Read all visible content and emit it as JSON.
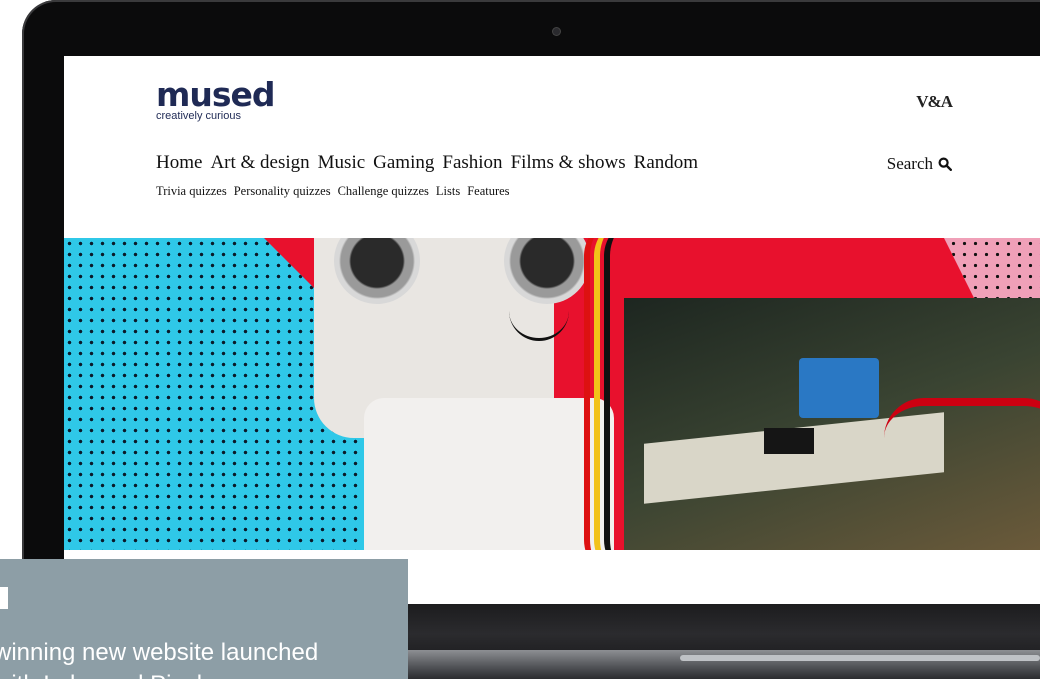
{
  "site": {
    "logo": "mused",
    "tagline": "creatively curious",
    "partner_logo": "V&A"
  },
  "main_nav": [
    "Home",
    "Art & design",
    "Music",
    "Gaming",
    "Fashion",
    "Films & shows",
    "Random"
  ],
  "search": {
    "label": "Search",
    "icon": "search-icon"
  },
  "sub_nav": [
    "Trivia quizzes",
    "Personality quizzes",
    "Challenge quizzes",
    "Lists",
    "Features"
  ],
  "press_panel": {
    "text_line_1": "winning new website launched",
    "text_line_2": "with Lobo and Pixel"
  },
  "colors": {
    "brand": "#1f2a55",
    "hero_red": "#e8112d",
    "hero_cyan": "#2fc8e8",
    "panel": "#8d9ea6"
  }
}
